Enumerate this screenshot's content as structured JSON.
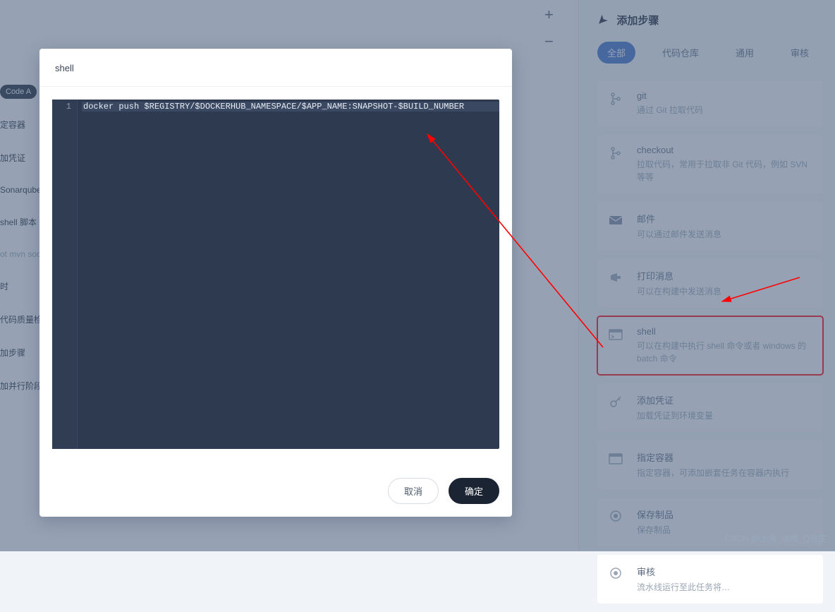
{
  "zoom": {
    "plus": "+",
    "minus": "−"
  },
  "left": {
    "codeBtn": "Code A",
    "items": [
      "定容器",
      "加凭证",
      "Sonarqube",
      "shell 脚本",
      "ot  mvn soc",
      "时",
      "代码质量检",
      "加步骤",
      "加并行阶段"
    ]
  },
  "rightPanel": {
    "title": "添加步骤",
    "tabs": [
      "全部",
      "代码仓库",
      "通用",
      "审核"
    ],
    "activeTab": 0,
    "steps": [
      {
        "title": "git",
        "desc": "通过 Git 拉取代码",
        "icon": "git"
      },
      {
        "title": "checkout",
        "desc": "拉取代码，常用于拉取非 Git 代码，例如 SVN 等等",
        "icon": "checkout"
      },
      {
        "title": "邮件",
        "desc": "可以通过邮件发送消息",
        "icon": "mail"
      },
      {
        "title": "打印消息",
        "desc": "可以在构建中发送消息",
        "icon": "announce"
      },
      {
        "title": "shell",
        "desc": "可以在构建中执行 shell 命令或者 windows 的 batch 命令",
        "icon": "shell"
      },
      {
        "title": "添加凭证",
        "desc": "加载凭证到环境变量",
        "icon": "key"
      },
      {
        "title": "指定容器",
        "desc": "指定容器，可添加嵌套任务在容器内执行",
        "icon": "container"
      },
      {
        "title": "保存制品",
        "desc": "保存制品",
        "icon": "record"
      },
      {
        "title": "审核",
        "desc": "流水线运行至此任务将…",
        "icon": "record"
      }
    ],
    "highlightIndex": 4
  },
  "modal": {
    "title": "shell",
    "code": {
      "lineNo": "1",
      "line": "docker push $REGISTRY/$DOCKERHUB_NAMESPACE/$APP_NAME:SNAPSHOT-$BUILD_NUMBER"
    },
    "cancel": "取消",
    "confirm": "确定"
  },
  "watermark": "CSDN @上海_运维_Q先生"
}
